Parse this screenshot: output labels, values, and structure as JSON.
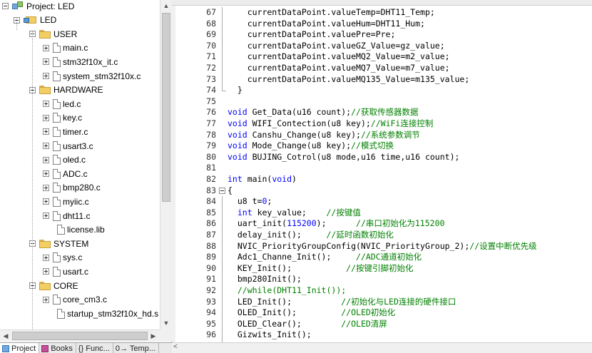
{
  "project_panel": {
    "root_label": "Project: LED",
    "target_label": "LED",
    "groups": [
      {
        "name": "USER",
        "files": [
          "main.c",
          "stm32f10x_it.c",
          "system_stm32f10x.c"
        ]
      },
      {
        "name": "HARDWARE",
        "files": [
          "led.c",
          "key.c",
          "timer.c",
          "usart3.c",
          "oled.c",
          "ADC.c",
          "bmp280.c",
          "myiic.c",
          "dht11.c",
          "license.lib"
        ]
      },
      {
        "name": "SYSTEM",
        "files": [
          "sys.c",
          "usart.c"
        ]
      },
      {
        "name": "CORE",
        "files": [
          "core_cm3.c",
          "startup_stm32f10x_hd.s"
        ]
      }
    ],
    "tabs": [
      "Project",
      "Books",
      "{} Func...",
      "0→ Temp..."
    ]
  },
  "editor": {
    "lines": [
      {
        "n": "67",
        "code": "    currentDataPoint.valueTemp=DHT11_Temp;"
      },
      {
        "n": "68",
        "code": "    currentDataPoint.valueHum=DHT11_Hum;"
      },
      {
        "n": "69",
        "code": "    currentDataPoint.valuePre=Pre;"
      },
      {
        "n": "70",
        "code": "    currentDataPoint.valueGZ_Value=gz_value;"
      },
      {
        "n": "71",
        "code": "    currentDataPoint.valueMQ2_Value=m2_value;"
      },
      {
        "n": "72",
        "code": "    currentDataPoint.valueMQ7_Value=m7_value;"
      },
      {
        "n": "73",
        "code": "    currentDataPoint.valueMQ135_Value=m135_value;"
      },
      {
        "n": "74",
        "code": "  }"
      },
      {
        "n": "75",
        "code": ""
      },
      {
        "n": "76",
        "code": "void Get_Data(u16 count);//获取传感器数据"
      },
      {
        "n": "77",
        "code": "void WIFI_Contection(u8 key);//WiFi连接控制"
      },
      {
        "n": "78",
        "code": "void Canshu_Change(u8 key);//系统参数调节"
      },
      {
        "n": "79",
        "code": "void Mode_Change(u8 key);//模式切换"
      },
      {
        "n": "80",
        "code": "void BUJING_Cotrol(u8 mode,u16 time,u16 count);"
      },
      {
        "n": "81",
        "code": ""
      },
      {
        "n": "82",
        "code": "int main(void)"
      },
      {
        "n": "83",
        "code": "{"
      },
      {
        "n": "84",
        "code": "  u8 t=0;"
      },
      {
        "n": "85",
        "code": "  int key_value;    //按键值"
      },
      {
        "n": "86",
        "code": "  uart_init(115200);      //串口初始化为115200"
      },
      {
        "n": "87",
        "code": "  delay_init();     //延时函数初始化"
      },
      {
        "n": "88",
        "code": "  NVIC_PriorityGroupConfig(NVIC_PriorityGroup_2);//设置中断优先级"
      },
      {
        "n": "89",
        "code": "  Adc1_Channe_Init();     //ADC通道初始化"
      },
      {
        "n": "90",
        "code": "  KEY_Init();           //按键引脚初始化"
      },
      {
        "n": "91",
        "code": "  bmp280Init();"
      },
      {
        "n": "92",
        "code": "  //while(DHT11_Init());"
      },
      {
        "n": "93",
        "code": "  LED_Init();          //初始化与LED连接的硬件接口"
      },
      {
        "n": "94",
        "code": "  OLED_Init();         //OLED初始化"
      },
      {
        "n": "95",
        "code": "  OLED_Clear();        //OLED清屏"
      },
      {
        "n": "96",
        "code": "  Gizwits_Init();"
      }
    ]
  },
  "colors": {
    "keyword": "#0000ff",
    "comment": "#008000",
    "folder": "#f3cf63"
  },
  "icons": [
    "minus-box-icon",
    "plus-box-icon",
    "folder-icon",
    "file-icon",
    "project-icon",
    "target-icon"
  ]
}
